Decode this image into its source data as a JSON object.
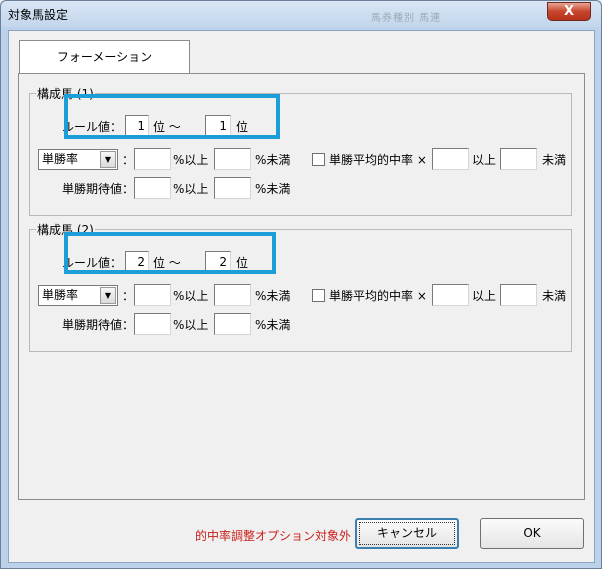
{
  "window": {
    "title": "対象馬設定",
    "ghost_text": "馬券種別 馬連",
    "close_glyph": "X"
  },
  "tab": {
    "label": "フォーメーション"
  },
  "groups": [
    {
      "label": "構成馬 (1)",
      "rule_label": "ルール値：",
      "rule_from": "1",
      "rule_mid": "位 〜",
      "rule_to": "1",
      "rule_end": "位",
      "select_value": "単勝率",
      "colon": "：",
      "pct_min_label": "%以上",
      "pct_max_label": "%未満",
      "check_label": "単勝平均的中率 ×",
      "ijo": "以上",
      "miman": "未満",
      "expect_label": "単勝期待値：",
      "expect_min_label": "%以上",
      "expect_max_label": "%未満"
    },
    {
      "label": "構成馬 (2)",
      "rule_label": "ルール値：",
      "rule_from": "2",
      "rule_mid": "位 〜",
      "rule_to": "2",
      "rule_end": "位",
      "select_value": "単勝率",
      "colon": "：",
      "pct_min_label": "%以上",
      "pct_max_label": "%未満",
      "check_label": "単勝平均的中率 ×",
      "ijo": "以上",
      "miman": "未満",
      "expect_label": "単勝期待値：",
      "expect_min_label": "%以上",
      "expect_max_label": "%未満"
    }
  ],
  "footer": {
    "note": "的中率調整オプション対象外",
    "cancel_label": "キャンセル",
    "ok_label": "OK"
  },
  "colors": {
    "highlight": "#1e9ed8",
    "note": "#c8201c"
  }
}
